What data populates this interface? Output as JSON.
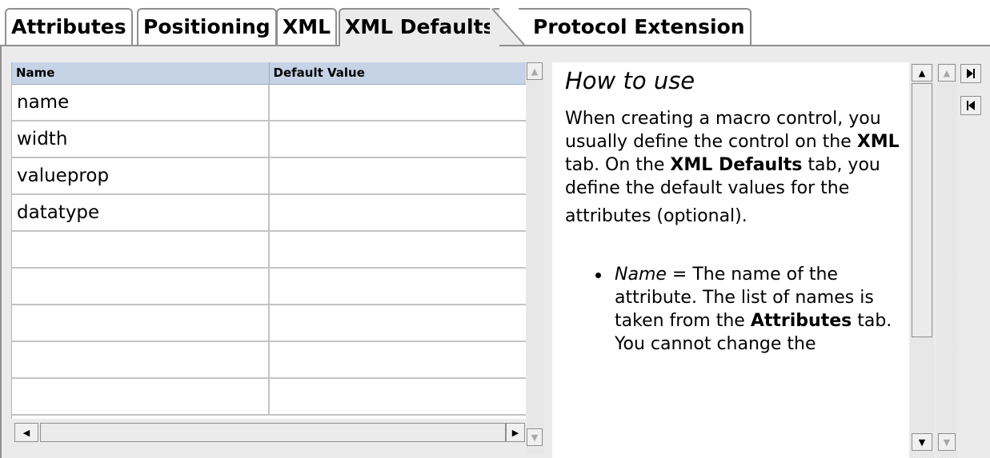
{
  "tabs": [
    {
      "label": "Attributes",
      "active": false
    },
    {
      "label": "Positioning",
      "active": false
    },
    {
      "label": "XML",
      "active": false
    },
    {
      "label": "XML Defaults",
      "active": true
    },
    {
      "label": "Protocol Extension",
      "active": false
    }
  ],
  "grid": {
    "columns": [
      "Name",
      "Default Value"
    ],
    "rows": [
      {
        "name": "name",
        "default": ""
      },
      {
        "name": "width",
        "default": ""
      },
      {
        "name": "valueprop",
        "default": ""
      },
      {
        "name": "datatype",
        "default": ""
      },
      {
        "name": "",
        "default": ""
      },
      {
        "name": "",
        "default": ""
      },
      {
        "name": "",
        "default": ""
      },
      {
        "name": "",
        "default": ""
      },
      {
        "name": "",
        "default": ""
      }
    ]
  },
  "help": {
    "title": "How to use",
    "para1_a": "When creating a macro control, you usually define the control on the ",
    "para1_b": "XML",
    "para1_c": " tab. On the ",
    "para1_d": "XML Defaults",
    "para1_e": " tab, you define the default values for the",
    "para2": "attributes (optional).",
    "bullet_a": "Name",
    "bullet_b": " = The name of the attribute. The list of names is taken from the ",
    "bullet_c": "Attributes",
    "bullet_d": " tab. You cannot change the"
  },
  "icons": {
    "scroll_up": "arrow-up-icon",
    "scroll_down": "arrow-down-icon",
    "scroll_left": "arrow-left-icon",
    "scroll_right": "arrow-right-icon",
    "nav_last": "skip-to-end-icon",
    "nav_first": "skip-to-start-icon"
  }
}
